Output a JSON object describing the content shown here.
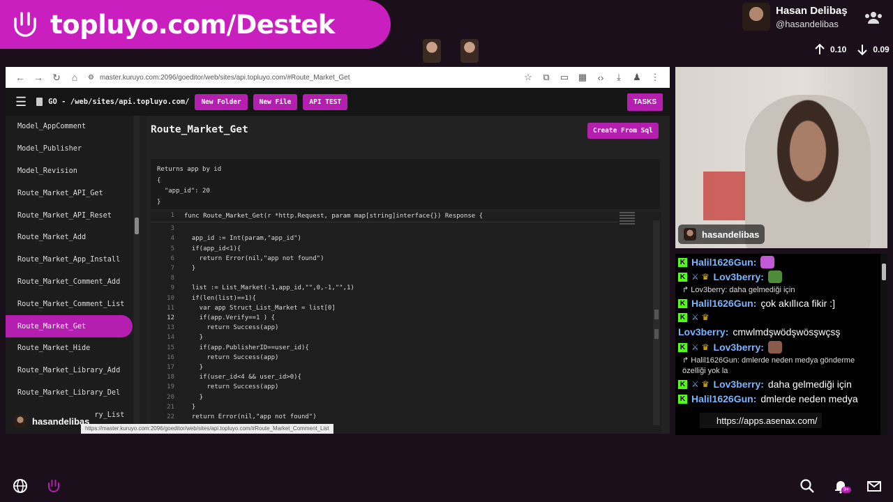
{
  "overlay": {
    "banner_text": "topluyo.com/Destek",
    "profile_name": "Hasan Delibaş",
    "profile_handle": "@hasandelibas",
    "net_up": "0.10",
    "net_down": "0.09"
  },
  "browser": {
    "url": "master.kuruyo.com:2096/goeditor/web/sites/api.topluyo.com/#Route_Market_Get",
    "status_url": "https://master.kuruyo.com:2096/goeditor/web/sites/api.topluyo.com/#Route_Market_Comment_List"
  },
  "app": {
    "path": "GO - /web/sites/api.topluyo.com/",
    "new_folder": "New Folder",
    "new_file": "New File",
    "api_test": "API TEST",
    "tasks": "TASKS",
    "page_title": "Route_Market_Get",
    "create_from_sql": "Create From Sql",
    "doc_text": "Returns app by id\n{\n  \"app_id\": 20\n}"
  },
  "sidebar": {
    "items": [
      {
        "label": "Model_AppComment",
        "active": false
      },
      {
        "label": "Model_Publisher",
        "active": false
      },
      {
        "label": "Model_Revision",
        "active": false
      },
      {
        "label": "Route_Market_API_Get",
        "active": false
      },
      {
        "label": "Route_Market_API_Reset",
        "active": false
      },
      {
        "label": "Route_Market_Add",
        "active": false
      },
      {
        "label": "Route_Market_App_Install",
        "active": false
      },
      {
        "label": "Route_Market_Comment_Add",
        "active": false
      },
      {
        "label": "Route_Market_Comment_List",
        "active": false
      },
      {
        "label": "Route_Market_Get",
        "active": true
      },
      {
        "label": "Route_Market_Hide",
        "active": false
      },
      {
        "label": "Route_Market_Library_Add",
        "active": false
      },
      {
        "label": "Route_Market_Library_Del",
        "active": false
      },
      {
        "label": "Route_Market_Library_List",
        "active": false
      }
    ]
  },
  "editor": {
    "func_line": "func Route_Market_Get(r *http.Request, param map[string]interface{}) Response {",
    "current_line": "12",
    "lines": [
      {
        "n": "1",
        "text": ""
      },
      {
        "n": "3",
        "text": ""
      },
      {
        "n": "4",
        "text": "  app_id := Int(param,\"app_id\")"
      },
      {
        "n": "5",
        "text": "  if(app_id<1){"
      },
      {
        "n": "6",
        "text": "    return Error(nil,\"app not found\")"
      },
      {
        "n": "7",
        "text": "  }"
      },
      {
        "n": "8",
        "text": ""
      },
      {
        "n": "9",
        "text": "  list := List_Market(-1,app_id,\"\",0,-1,\"\",1)"
      },
      {
        "n": "10",
        "text": "  if(len(list)==1){"
      },
      {
        "n": "11",
        "text": "    var app Struct_List_Market = list[0]"
      },
      {
        "n": "12",
        "text": "    if(app.Verify==1 ) {"
      },
      {
        "n": "13",
        "text": "      return Success(app)"
      },
      {
        "n": "14",
        "text": "    }"
      },
      {
        "n": "15",
        "text": "    if(app.PublisherID==user_id){"
      },
      {
        "n": "16",
        "text": "      return Success(app)"
      },
      {
        "n": "17",
        "text": "    }"
      },
      {
        "n": "18",
        "text": "    if(user_id<4 && user_id>0){"
      },
      {
        "n": "19",
        "text": "      return Success(app)"
      },
      {
        "n": "20",
        "text": "    }"
      },
      {
        "n": "21",
        "text": "  }"
      },
      {
        "n": "22",
        "text": "  return Error(nil,\"app not found\")"
      }
    ]
  },
  "webcam": {
    "name": "hasandelibas"
  },
  "screen_chip": {
    "name": "hasandelibas"
  },
  "chat": {
    "messages": [
      {
        "user": "Halil1626Gun:",
        "badges": "k",
        "text": "",
        "emote": "#c25ad8",
        "reply": ""
      },
      {
        "user": "Lov3berry:",
        "badges": "ksc",
        "text": "",
        "emote": "#4f8c3a",
        "reply": ""
      },
      {
        "user": "",
        "badges": "",
        "text": "",
        "emote": "",
        "reply": "↱ Lov3berry: daha gelmediği için"
      },
      {
        "user": "Halil1626Gun:",
        "badges": "k",
        "text": "çok akıllıca fikir :]",
        "emote": "",
        "reply": ""
      },
      {
        "user": "",
        "badges": "ksc",
        "text": "",
        "emote": "",
        "reply": ""
      },
      {
        "user": "Lov3berry:",
        "badges": "",
        "text": "cmwlmdşwödşwösşwçsş",
        "emote": "",
        "reply": ""
      },
      {
        "user": "Lov3berry:",
        "badges": "ksc",
        "text": "",
        "emote": "#8a5a4a",
        "reply": ""
      },
      {
        "user": "",
        "badges": "",
        "text": "",
        "emote": "",
        "reply": "↱ Halil1626Gun: dmlerde neden medya gönderme"
      },
      {
        "user": "",
        "badges": "",
        "text": "",
        "emote": "",
        "reply": "özelliği yok la"
      },
      {
        "user": "Lov3berry:",
        "badges": "ksc",
        "text": "daha gelmediği için",
        "emote": "",
        "reply": ""
      },
      {
        "user": "Halil1626Gun:",
        "badges": "k",
        "text": "dmlerde neden medya",
        "emote": "",
        "reply": ""
      }
    ],
    "link": "https://apps.asenax.com/"
  },
  "bottom": {
    "notif_count": "9+"
  },
  "colors": {
    "brand": "#b51fb0",
    "banner": "#c81fbe",
    "kick_green": "#53fc18",
    "chat_user": "#7ab6ff"
  }
}
